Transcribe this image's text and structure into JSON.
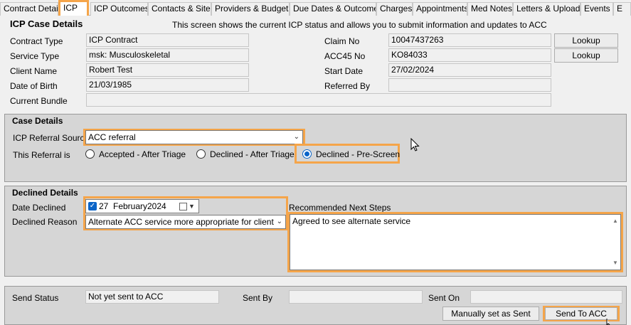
{
  "tabs": [
    {
      "label": "Contract Details"
    },
    {
      "label": "ICP"
    },
    {
      "label": "ICP Outcomes"
    },
    {
      "label": "Contacts & Sites"
    },
    {
      "label": "Providers & Budgets"
    },
    {
      "label": "Due Dates & Outcomes"
    },
    {
      "label": "Charges"
    },
    {
      "label": "Appointments"
    },
    {
      "label": "Med Notes"
    },
    {
      "label": "Letters & Uploads"
    },
    {
      "label": "Events"
    },
    {
      "label": "E"
    }
  ],
  "header": {
    "title": "ICP Case Details",
    "description": "This screen shows the current ICP status and allows you to submit information and updates to ACC"
  },
  "case_info": {
    "contract_type_label": "Contract Type",
    "contract_type_value": "ICP Contract",
    "service_type_label": "Service Type",
    "service_type_value": "msk: Musculoskeletal",
    "client_name_label": "Client Name",
    "client_name_value": "Robert Test",
    "dob_label": "Date of Birth",
    "dob_value": "21/03/1985",
    "current_bundle_label": "Current Bundle",
    "current_bundle_value": "",
    "claim_no_label": "Claim No",
    "claim_no_value": "10047437263",
    "acc45_label": "ACC45 No",
    "acc45_value": "KO84033",
    "start_date_label": "Start Date",
    "start_date_value": "27/02/2024",
    "referred_by_label": "Referred By",
    "referred_by_value": "",
    "lookup_label": "Lookup"
  },
  "case_details": {
    "title": "Case Details",
    "referral_source_label": "ICP Referral Source",
    "referral_source_value": "ACC referral",
    "referral_is_label": "This Referral is",
    "options": [
      {
        "label": "Accepted - After Triage",
        "selected": false
      },
      {
        "label": "Declined - After Triage",
        "selected": false
      },
      {
        "label": "Declined - Pre-Screen",
        "selected": true
      }
    ]
  },
  "declined_details": {
    "title": "Declined Details",
    "date_label": "Date Declined",
    "date_day": "27",
    "date_month": "February",
    "date_year": "2024",
    "reason_label": "Declined Reason",
    "reason_value": "Alternate ACC service more appropriate for client",
    "next_steps_label": "Recommended Next Steps",
    "next_steps_value": "Agreed to see alternate service"
  },
  "send": {
    "status_label": "Send Status",
    "status_value": "Not yet sent to ACC",
    "sent_by_label": "Sent By",
    "sent_by_value": "",
    "sent_on_label": "Sent On",
    "sent_on_value": "",
    "manual_button": "Manually set as Sent",
    "send_button": "Send To ACC"
  },
  "colors": {
    "highlight": "#f5a54a",
    "radio_selected": "#0a64c8",
    "checkbox": "#0a64c8"
  }
}
